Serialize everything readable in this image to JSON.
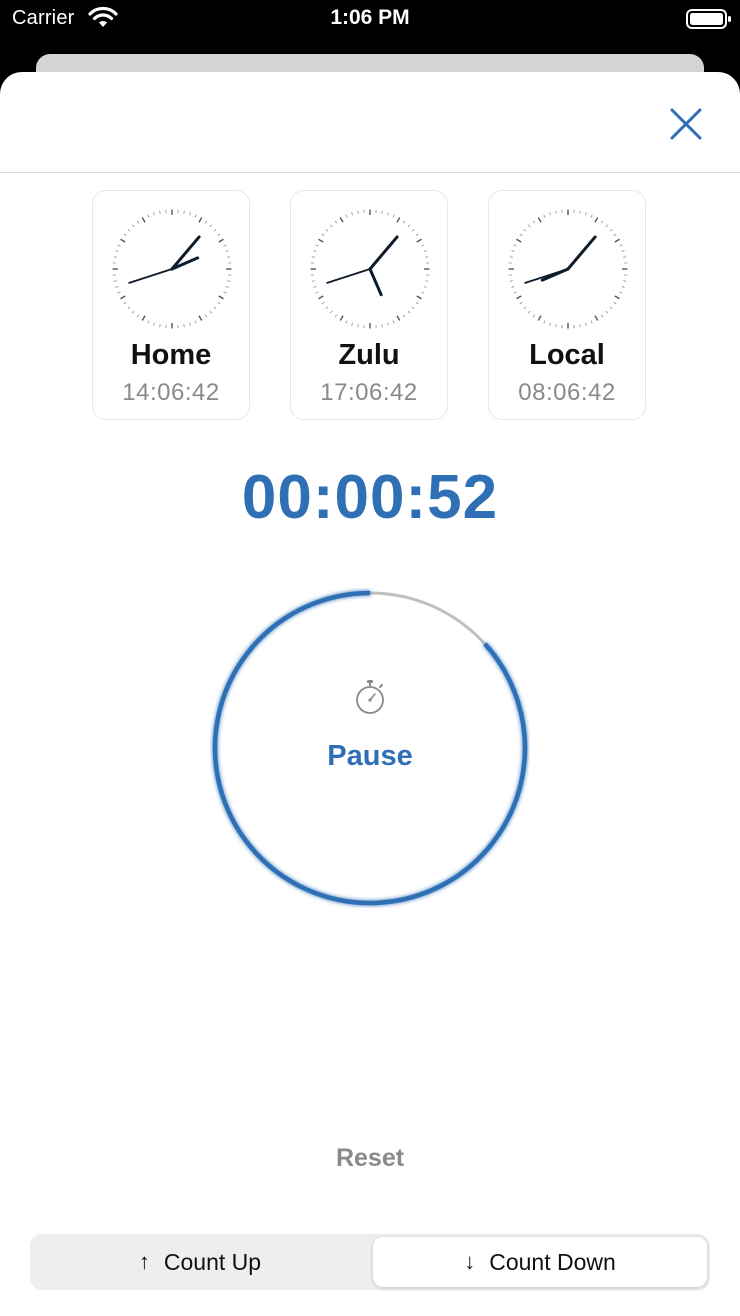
{
  "status_bar": {
    "carrier": "Carrier",
    "time": "1:06 PM",
    "icons": [
      "wifi-icon",
      "battery-icon"
    ]
  },
  "header": {
    "close_icon": "close-icon"
  },
  "clocks": [
    {
      "name": "Home",
      "time": "14:06:42"
    },
    {
      "name": "Zulu",
      "time": "17:06:42"
    },
    {
      "name": "Local",
      "time": "08:06:42"
    }
  ],
  "timer": {
    "elapsed": "00:00:52",
    "action_label": "Pause",
    "icon": "stopwatch-icon",
    "progress_fraction": 0.867
  },
  "reset_label": "Reset",
  "mode_control": {
    "options": [
      {
        "label": "Count Up",
        "icon": "arrow-up-icon",
        "selected": false
      },
      {
        "label": "Count Down",
        "icon": "arrow-down-icon",
        "selected": true
      }
    ]
  },
  "colors": {
    "accent": "#2f6fb5",
    "ring_track": "#c0c0c2",
    "secondary_text": "#8a8a8e",
    "clock_hands": "#0d1b2a"
  }
}
